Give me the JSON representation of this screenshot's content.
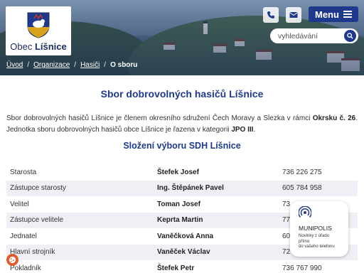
{
  "header": {
    "municipality_prefix": "Obec",
    "municipality_name": "Líšnice",
    "menu_label": "Menu",
    "phone_icon": "phone-icon",
    "mail_icon": "mail-icon"
  },
  "search": {
    "placeholder": "vyhledávání",
    "icon": "search-icon"
  },
  "breadcrumb": {
    "items": [
      "Úvod",
      "Organizace",
      "Hasiči"
    ],
    "separator": "/",
    "current": "O sboru"
  },
  "main": {
    "title": "Sbor dobrovolných hasičů Líšnice",
    "intro_text_1": "Sbor dobrovolných hasičů Líšnice je členem okresního sdružení Čech Moravy a Slezka v rámci ",
    "intro_bold_1": "Okrsku č. 26",
    "intro_text_2": ". Jednotka sboru dobrovolných hasičů obce Líšnice je řazena v kategorii ",
    "intro_bold_2": "JPO III",
    "intro_text_3": ".",
    "committee_title": "Složení výboru SDH Líšnice"
  },
  "committee": [
    {
      "role": "Starosta",
      "name": "Štefek Josef",
      "phone": "736 226 275"
    },
    {
      "role": "Zástupce starosty",
      "name": "Ing. Štěpánek Pavel",
      "phone": "605 784 958"
    },
    {
      "role": "Velitel",
      "name": "Toman Josef",
      "phone": "73"
    },
    {
      "role": "Zástupce velitele",
      "name": "Keprta Martin",
      "phone": "77"
    },
    {
      "role": "Jednatel",
      "name": "Vaněčková Anna",
      "phone": "60"
    },
    {
      "role": "Hlavní strojník",
      "name": "Vaněček Václav",
      "phone": "72"
    },
    {
      "role": "Pokladník",
      "name": "Štefek Petr",
      "phone": "736 767 990"
    }
  ],
  "munipolis": {
    "name": "MUNIPOLIS",
    "desc_1": "Novinky z úřadu",
    "desc_2": "přímo",
    "desc_3": "do vašeho telefonu"
  },
  "colors": {
    "primary": "#1f3a8c",
    "row_alt": "#eef0f5",
    "cookie": "#e05a2b"
  }
}
